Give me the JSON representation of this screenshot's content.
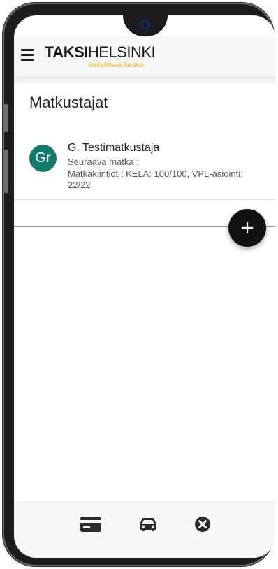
{
  "header": {
    "logo_bold": "TAKSI",
    "logo_light": "HELSINKI",
    "logo_tagline": "Siellä Missä Sinäkin"
  },
  "page": {
    "title": "Matkustajat"
  },
  "passengers": [
    {
      "avatar_initials": "Gr",
      "name": "G. Testimatkustaja",
      "next_trip": "Seuraava matka :",
      "quotas": "Matkakiintiöt : KELA: 100/100, VPL-asiointi: 22/22"
    }
  ],
  "fab": {
    "glyph": "+"
  },
  "icons": {
    "menu": "hamburger-menu-icon",
    "add": "plus-icon",
    "card": "credit-card-icon",
    "taxi": "taxi-car-icon",
    "close": "close-circle-icon"
  },
  "colors": {
    "avatar": "#127a68",
    "tagline": "#e8b400",
    "fab": "#111111",
    "icon": "#2b2b2b"
  }
}
